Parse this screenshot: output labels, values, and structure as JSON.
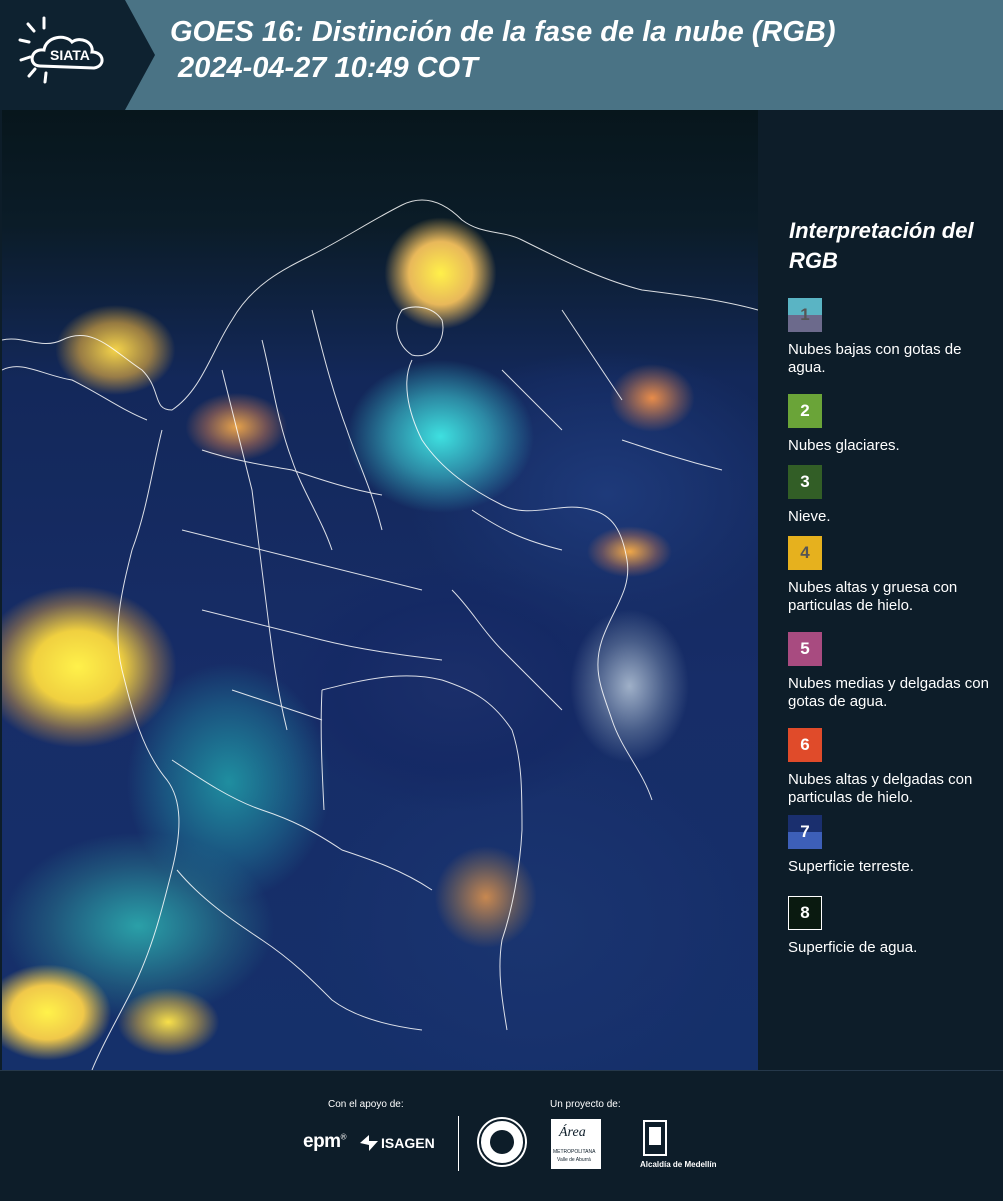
{
  "header": {
    "logo_text": "SIATA",
    "title_line1": "GOES 16: Distinción de la fase de la nube (RGB)",
    "title_line2": " 2024-04-27 10:49 COT"
  },
  "legend": {
    "title": "Interpretación del RGB",
    "items": [
      {
        "number": "1",
        "label": "Nubes bajas con gotas de agua.",
        "color_top": "#5ab4c4",
        "color_bottom": "#6c6a8c",
        "text_color": "#555555"
      },
      {
        "number": "2",
        "label": "Nubes glaciares.",
        "color_top": "#6aa438",
        "color_bottom": "#6aa438",
        "text_color": "#ffffff"
      },
      {
        "number": "3",
        "label": "Nieve.",
        "color_top": "#325e26",
        "color_bottom": "#325e26",
        "text_color": "#ffffff"
      },
      {
        "number": "4",
        "label": "Nubes altas y gruesa con particulas de hielo.",
        "color_top": "#e6b11e",
        "color_bottom": "#e6b11e",
        "text_color": "#555555"
      },
      {
        "number": "5",
        "label": "Nubes medias y delgadas con gotas de agua.",
        "color_top": "#a84b80",
        "color_bottom": "#a84b80",
        "text_color": "#ffffff"
      },
      {
        "number": "6",
        "label": "Nubes altas y delgadas con particulas de hielo.",
        "color_top": "#e04b2a",
        "color_bottom": "#e04b2a",
        "text_color": "#ffffff"
      },
      {
        "number": "7",
        "label": "Superficie terreste.",
        "color_top": "#1a2f6e",
        "color_bottom": "#3d5fb8",
        "text_color": "#ffffff"
      },
      {
        "number": "8",
        "label": "Superficie de agua.",
        "color_top": "#0a1a10",
        "color_bottom": "#0a1a10",
        "text_color": "#ffffff"
      }
    ]
  },
  "footer": {
    "support_label": "Con el apoyo de:",
    "project_label": "Un proyecto de:",
    "epm_text": "epm",
    "isagen_text": "ISAGEN",
    "area_text": "Área",
    "area_subtext": "METROPOLITANA",
    "area_subtext2": "Valle de Aburrá",
    "alcaldia_text": "Alcaldía de Medellín"
  }
}
